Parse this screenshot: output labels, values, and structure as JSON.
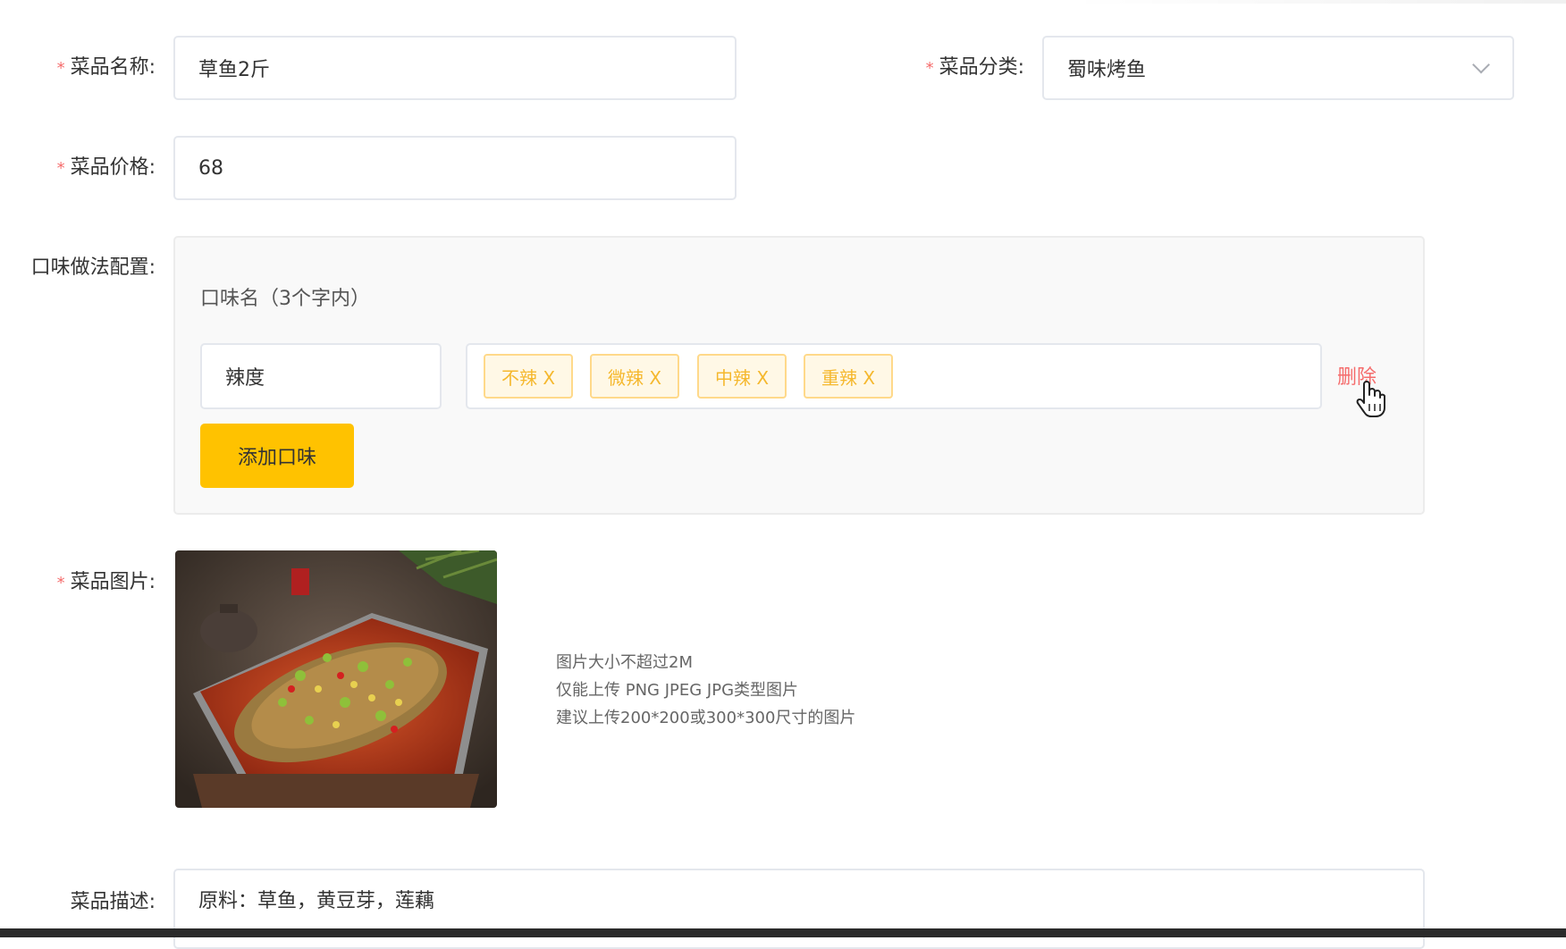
{
  "form": {
    "name": {
      "label": "菜品名称:",
      "value": "草鱼2斤"
    },
    "category": {
      "label": "菜品分类:",
      "value": "蜀味烤鱼"
    },
    "price": {
      "label": "菜品价格:",
      "value": "68"
    },
    "flavor": {
      "label": "口味做法配置:",
      "title": "口味名（3个字内）",
      "name_value": "辣度",
      "tags": [
        "不辣 X",
        "微辣 X",
        "中辣 X",
        "重辣 X"
      ],
      "delete_label": "删除",
      "add_label": "添加口味"
    },
    "image": {
      "label": "菜品图片:",
      "hints": [
        "图片大小不超过2M",
        "仅能上传 PNG JPEG JPG类型图片",
        "建议上传200*200或300*300尺寸的图片"
      ]
    },
    "description": {
      "label": "菜品描述:",
      "value": "原料：草鱼，黄豆芽，莲藕"
    }
  },
  "required_mark": "*",
  "colors": {
    "accent": "#ffc200",
    "required": "#f56c6c",
    "tag_text": "#f5b82e",
    "tag_border": "#ffd98a",
    "tag_bg": "#fff8e6"
  },
  "icons": [
    "chevron-down-icon",
    "hand-cursor-icon"
  ]
}
